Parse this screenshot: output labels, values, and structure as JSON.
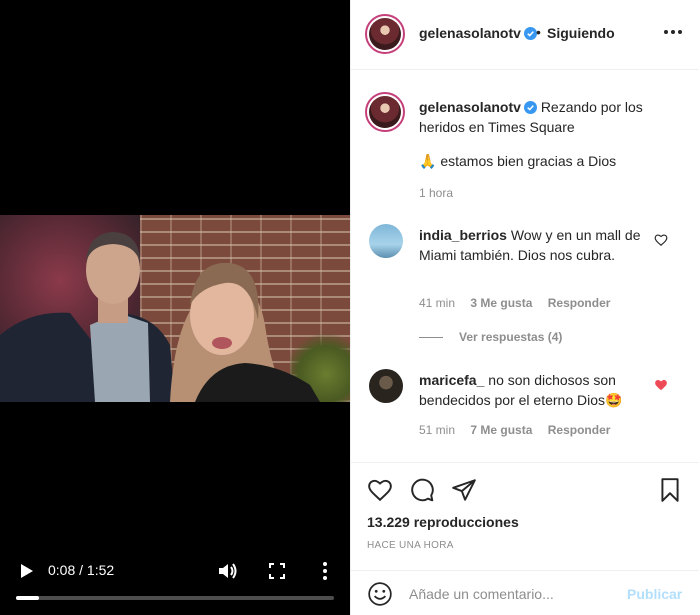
{
  "video": {
    "time_label": "0:08 / 1:52",
    "progress_fraction": 0.071,
    "icons": {
      "play": "play-icon",
      "volume": "volume-icon",
      "fullscreen": "fullscreen-icon",
      "more": "more-vertical-icon"
    }
  },
  "header": {
    "username": "gelenasolanotv",
    "separator": "•",
    "follow_status": "Siguiendo",
    "icons": {
      "verified": "verified-badge-icon",
      "more": "more-horizontal-icon"
    }
  },
  "caption": {
    "username": "gelenasolanotv",
    "text": "Rezando por los heridos en Times Square",
    "line2": "🙏 estamos bien gracias a Dios",
    "time": "1 hora"
  },
  "comments": [
    {
      "username": "india_berrios",
      "text": "Wow y en un mall de Miami también. Dios nos cubra.",
      "time": "41 min",
      "likes": "3 Me gusta",
      "reply_label": "Responder",
      "liked": false,
      "replies_label": "Ver respuestas (4)"
    },
    {
      "username": "maricefa_",
      "text": "no son dichosos son bendecidos por el eterno Dios🤩",
      "time": "51 min",
      "likes": "7 Me gusta",
      "reply_label": "Responder",
      "liked": true
    }
  ],
  "actions": {
    "views": "13.229 reproducciones",
    "posted": "HACE UNA HORA",
    "icons": {
      "like": "heart-icon",
      "comment": "comment-icon",
      "share": "share-icon",
      "save": "bookmark-icon",
      "emoji": "emoji-icon"
    }
  },
  "add_comment": {
    "placeholder": "Añade un comentario...",
    "publish_label": "Publicar"
  },
  "colors": {
    "text": "#262626",
    "muted": "#8e8e8e",
    "verified": "#3897f0",
    "liked_heart": "#ed4956",
    "publish_disabled": "#b2dffc",
    "story_ring": "#c53f7a"
  }
}
